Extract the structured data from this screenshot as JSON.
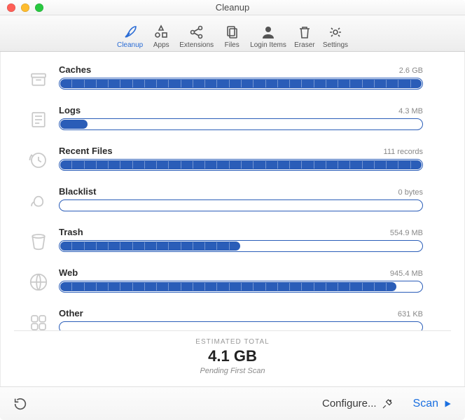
{
  "window": {
    "title": "Cleanup"
  },
  "toolbar": {
    "items": [
      {
        "label": "Cleanup",
        "active": true
      },
      {
        "label": "Apps"
      },
      {
        "label": "Extensions"
      },
      {
        "label": "Files"
      },
      {
        "label": "Login Items"
      },
      {
        "label": "Eraser"
      },
      {
        "label": "Settings"
      }
    ]
  },
  "categories": [
    {
      "key": "caches",
      "label": "Caches",
      "size": "2.6 GB",
      "fill_pct": 100
    },
    {
      "key": "logs",
      "label": "Logs",
      "size": "4.3 MB",
      "fill_pct": 8
    },
    {
      "key": "recent",
      "label": "Recent Files",
      "size": "111 records",
      "fill_pct": 100
    },
    {
      "key": "blacklist",
      "label": "Blacklist",
      "size": "0 bytes",
      "fill_pct": 0
    },
    {
      "key": "trash",
      "label": "Trash",
      "size": "554.9 MB",
      "fill_pct": 50
    },
    {
      "key": "web",
      "label": "Web",
      "size": "945.4 MB",
      "fill_pct": 93
    },
    {
      "key": "other",
      "label": "Other",
      "size": "631 KB",
      "fill_pct": 0
    }
  ],
  "estimate": {
    "label": "ESTIMATED TOTAL",
    "total": "4.1 GB",
    "sub": "Pending First Scan"
  },
  "footer": {
    "configure": "Configure...",
    "scan": "Scan"
  }
}
